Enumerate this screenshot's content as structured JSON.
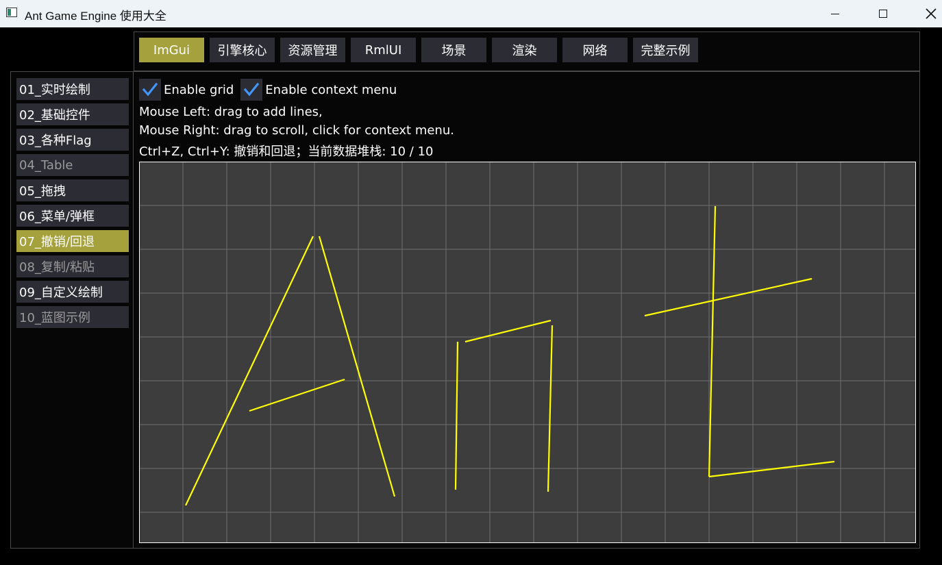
{
  "window": {
    "title": "Ant Game Engine 使用大全"
  },
  "tabs": [
    {
      "label": "ImGui",
      "active": true
    },
    {
      "label": "引擎核心",
      "active": false
    },
    {
      "label": "资源管理",
      "active": false
    },
    {
      "label": "RmlUI",
      "active": false
    },
    {
      "label": "场景",
      "active": false
    },
    {
      "label": "渲染",
      "active": false
    },
    {
      "label": "网络",
      "active": false
    },
    {
      "label": "完整示例",
      "active": false
    }
  ],
  "sidebar": {
    "items": [
      {
        "label": "01_实时绘制",
        "state": "normal"
      },
      {
        "label": "02_基础控件",
        "state": "normal"
      },
      {
        "label": "03_各种Flag",
        "state": "normal"
      },
      {
        "label": "04_Table",
        "state": "dim"
      },
      {
        "label": "05_拖拽",
        "state": "normal"
      },
      {
        "label": "06_菜单/弹框",
        "state": "normal"
      },
      {
        "label": "07_撤销/回退",
        "state": "active"
      },
      {
        "label": "08_复制/粘贴",
        "state": "dim"
      },
      {
        "label": "09_自定义绘制",
        "state": "normal"
      },
      {
        "label": "10_蓝图示例",
        "state": "dim"
      }
    ]
  },
  "options": {
    "enable_grid": {
      "label": "Enable grid",
      "checked": true
    },
    "enable_context_menu": {
      "label": "Enable context menu",
      "checked": true
    }
  },
  "info": {
    "line1": "Mouse Left: drag to add lines,",
    "line2": "Mouse Right: drag to scroll, click for context menu.",
    "line3": "Ctrl+Z, Ctrl+Y: 撤销和回退；当前数据堆栈: 10 / 10"
  },
  "colors": {
    "accent": "#a5a23d",
    "widget_bg": "#2c2c35",
    "canvas_bg": "#3d3d3d",
    "line_color": "#ffff00",
    "check_color": "#4296fa"
  },
  "icons": {
    "check": "check-icon",
    "minimize": "minimize-icon",
    "maximize": "maximize-icon",
    "close": "close-icon",
    "app": "app-icon"
  }
}
